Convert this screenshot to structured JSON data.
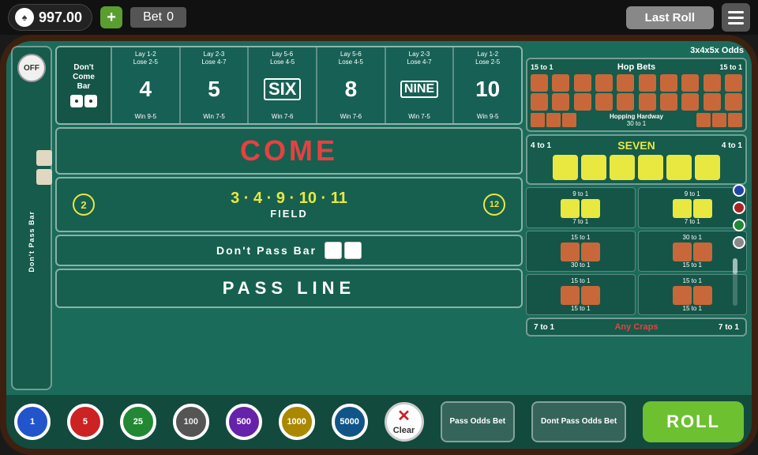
{
  "topbar": {
    "balance": "997.00",
    "bet_label": "Bet",
    "bet_value": "0",
    "last_roll_label": "Last Roll",
    "menu_icon": "menu"
  },
  "table": {
    "off_badge": "OFF",
    "dont_come_label": "Don't Come Bar",
    "pass_line_vertical": "PASS LINE",
    "dont_pass_vertical": "Don't Pass Bar",
    "numbers": [
      {
        "value": "4",
        "lay": "Lay 1-2",
        "lose": "Lose 2-5",
        "win": "Win 9-5"
      },
      {
        "value": "5",
        "lay": "Lay 2-3",
        "lose": "Lose 4-7",
        "win": "Win 7-5"
      },
      {
        "value": "SIX",
        "lay": "Lay 5-6",
        "lose": "Lose 4-5",
        "win": "Win 7-6"
      },
      {
        "value": "8",
        "lay": "Lay 5-6",
        "lose": "Lose 4-5",
        "win": "Win 7-6"
      },
      {
        "value": "NINE",
        "lay": "Lay 2-3",
        "lose": "Lose 4-7",
        "win": "Win 7-5"
      },
      {
        "value": "10",
        "lay": "Lay 1-2",
        "lose": "Lose 2-5",
        "win": "Win 9-5"
      }
    ],
    "come_label": "COME",
    "field_label": "FIELD",
    "field_numbers": "3 · 4 · 9 · 10 · 11",
    "field_2x": "2",
    "field_12x": "12",
    "dont_pass_bar": "Don't Pass Bar",
    "pass_line_label": "PASS LINE",
    "odds_title": "3x4x5x Odds",
    "hop_bets_label": "Hop Bets",
    "hop_left": "15 to 1",
    "hop_right": "15 to 1",
    "hopping_label": "Hopping Hardway",
    "hopping_odds": "30 to 1",
    "seven_label": "SEVEN",
    "seven_left": "4 to 1",
    "seven_right": "4 to 1",
    "nine_to_one_1": "9 to 1",
    "seven_to_one_1": "7 to 1",
    "nine_to_one_2": "9 to 1",
    "seven_to_one_2": "7 to 1",
    "r1_left": "15 to 1",
    "r1_mid": "30 to 1",
    "r1_right": "30 to 1",
    "r2_left": "15 to 1",
    "r2_right": "15 to 1",
    "any_craps_left": "7 to 1",
    "any_craps_label": "Any Craps",
    "any_craps_right": "7 to 1"
  },
  "chips": [
    {
      "value": "1",
      "class": "chip-1"
    },
    {
      "value": "5",
      "class": "chip-5"
    },
    {
      "value": "25",
      "class": "chip-25"
    },
    {
      "value": "100",
      "class": "chip-100"
    },
    {
      "value": "500",
      "class": "chip-500"
    },
    {
      "value": "1000",
      "class": "chip-1000"
    },
    {
      "value": "5000",
      "class": "chip-5000"
    }
  ],
  "buttons": {
    "clear": "Clear",
    "pass_odds": "Pass Odds Bet",
    "dont_pass_odds": "Dont Pass Odds Bet",
    "roll": "ROLL"
  }
}
